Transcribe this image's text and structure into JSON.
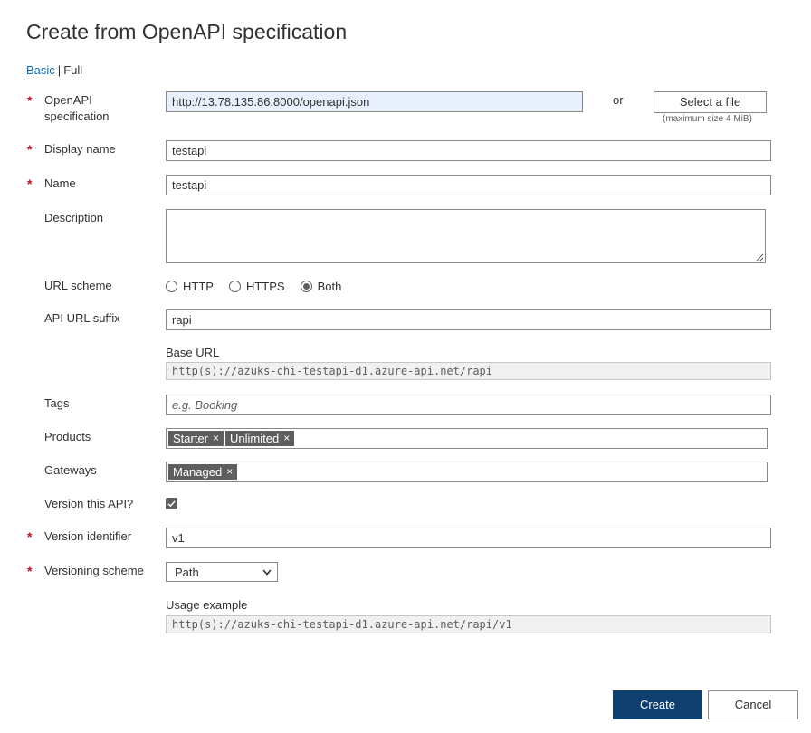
{
  "title": "Create from OpenAPI specification",
  "modes": {
    "basic": "Basic",
    "separator": "|",
    "full": "Full"
  },
  "required_mark": "*",
  "openapi": {
    "label_line1": "OpenAPI",
    "label_line2": "specification",
    "value": "http://13.78.135.86:8000/openapi.json",
    "or_text": "or",
    "select_file_label": "Select a file",
    "max_size_hint": "(maximum size 4 MiB)"
  },
  "display_name": {
    "label": "Display name",
    "value": "testapi"
  },
  "name": {
    "label": "Name",
    "value": "testapi"
  },
  "description": {
    "label": "Description",
    "value": ""
  },
  "url_scheme": {
    "label": "URL scheme",
    "options": [
      "HTTP",
      "HTTPS",
      "Both"
    ],
    "selected": "Both"
  },
  "api_url_suffix": {
    "label": "API URL suffix",
    "value": "rapi",
    "base_url_label": "Base URL",
    "base_url_value": "http(s)://azuks-chi-testapi-d1.azure-api.net/rapi"
  },
  "tags": {
    "label": "Tags",
    "placeholder": "e.g. Booking"
  },
  "products": {
    "label": "Products",
    "chips": [
      "Starter",
      "Unlimited"
    ]
  },
  "gateways": {
    "label": "Gateways",
    "chips": [
      "Managed"
    ]
  },
  "version_api": {
    "label": "Version this API?",
    "checked": true
  },
  "version_identifier": {
    "label": "Version identifier",
    "value": "v1"
  },
  "versioning_scheme": {
    "label": "Versioning scheme",
    "selected": "Path",
    "usage_label": "Usage example",
    "usage_value": "http(s)://azuks-chi-testapi-d1.azure-api.net/rapi/v1"
  },
  "chip_remove_glyph": "×",
  "buttons": {
    "create": "Create",
    "cancel": "Cancel"
  },
  "colors": {
    "primary_button": "#0e3f6e",
    "required": "#c50f1f",
    "link": "#0f6cbd",
    "chip": "#605e5c",
    "highlight_input": "#e8f0fe"
  }
}
